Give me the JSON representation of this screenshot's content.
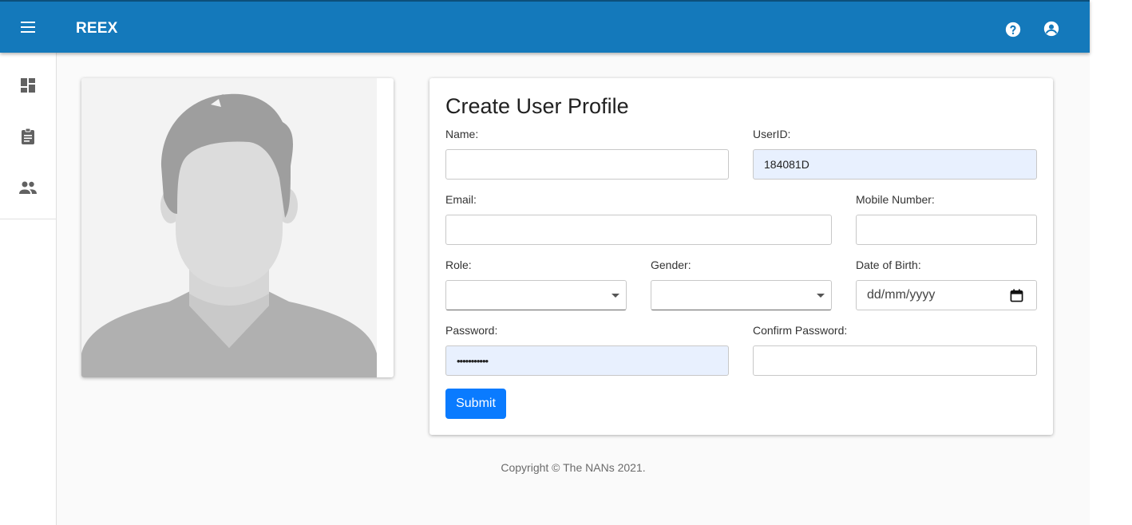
{
  "header": {
    "app_title": "REEX",
    "menu_icon": "menu-icon",
    "help_icon": "help-icon",
    "account_icon": "account-circle-icon",
    "color": "#1479bb"
  },
  "sidebar": {
    "items": [
      {
        "icon": "dashboard-icon"
      },
      {
        "icon": "clipboard-icon"
      },
      {
        "icon": "people-icon"
      }
    ]
  },
  "profile_image": {
    "icon": "avatar-placeholder"
  },
  "form": {
    "title": "Create User Profile",
    "name_label": "Name:",
    "name_value": "",
    "userid_label": "UserID:",
    "userid_value": "184081D",
    "email_label": "Email:",
    "email_value": "",
    "mobile_label": "Mobile Number:",
    "mobile_value": "",
    "role_label": "Role:",
    "role_value": "",
    "gender_label": "Gender:",
    "gender_value": "",
    "dob_label": "Date of Birth:",
    "dob_placeholder": "dd/mm/yyyy",
    "password_label": "Password:",
    "password_value": "•••••••••••",
    "confirm_password_label": "Confirm Password:",
    "confirm_password_value": "",
    "submit_label": "Submit",
    "accent_color": "#0a7bff"
  },
  "footer": {
    "copyright": "Copyright © The NANs 2021."
  }
}
